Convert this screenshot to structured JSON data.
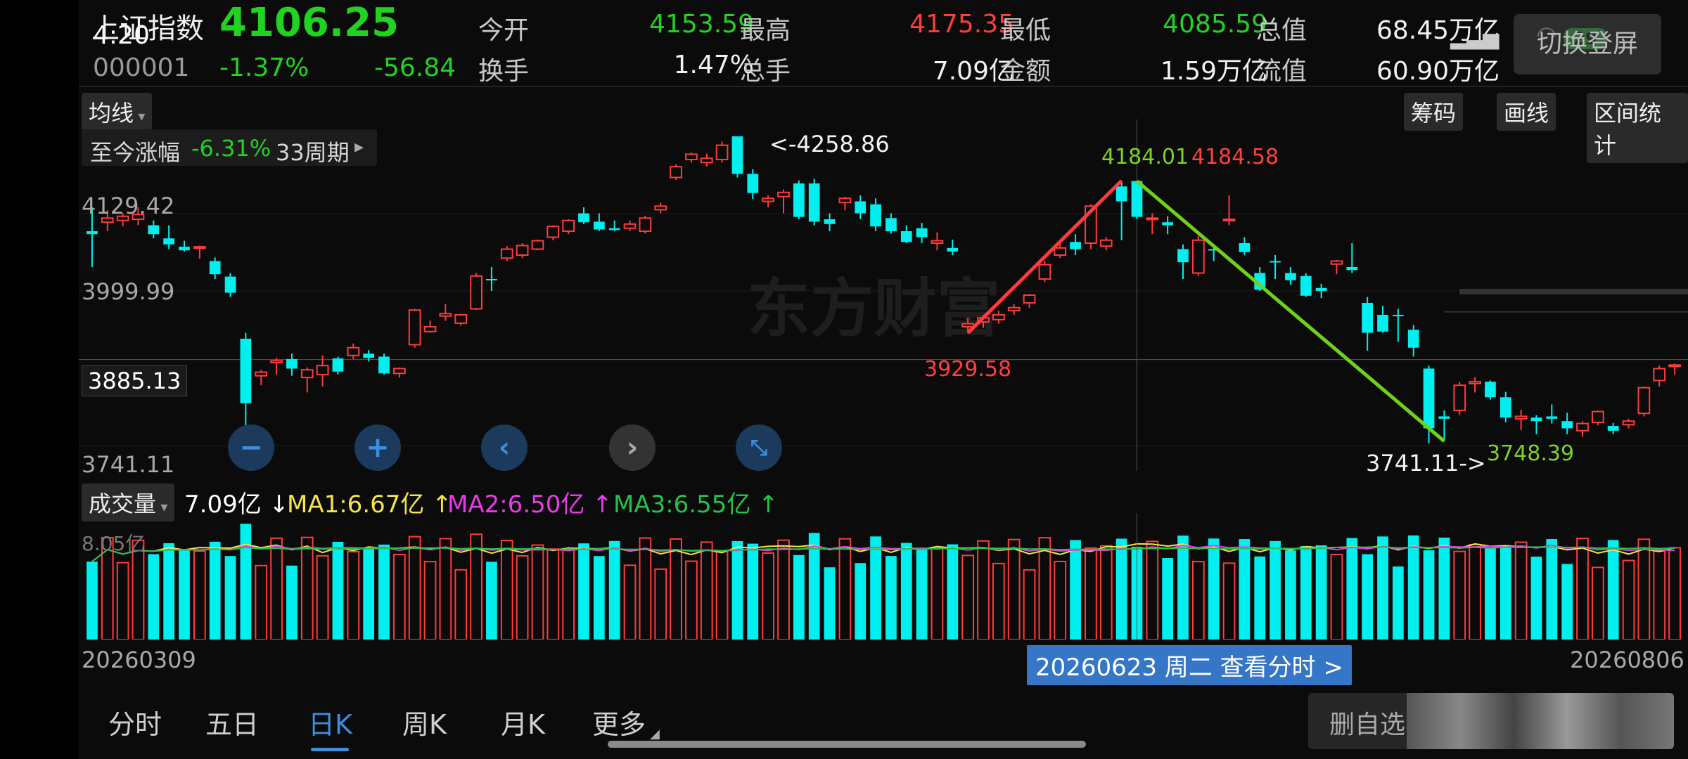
{
  "status": {
    "time": "4:20",
    "battery": "29"
  },
  "quote": {
    "name": "上证指数",
    "price": "4106.25",
    "code": "000001",
    "change_pct": "-1.37%",
    "change": "-56.84",
    "fields": [
      {
        "label": "今开",
        "value": "4153.59",
        "color": "dn"
      },
      {
        "label": "最高",
        "value": "4175.35",
        "color": "up"
      },
      {
        "label": "最低",
        "value": "4085.59",
        "color": "dn"
      },
      {
        "label": "总值",
        "value": "68.45万亿",
        "color": "wh"
      },
      {
        "label": "换手",
        "value": "1.47%",
        "color": "wh"
      },
      {
        "label": "总手",
        "value": "7.09亿",
        "color": "wh"
      },
      {
        "label": "金额",
        "value": "1.59万亿",
        "color": "wh"
      },
      {
        "label": "流值",
        "value": "60.90万亿",
        "color": "wh"
      }
    ],
    "action": "切换登屏"
  },
  "toolbar": {
    "ma_label": "均线",
    "tools": [
      "筹码",
      "画线",
      "区间统计"
    ]
  },
  "range": {
    "label": "至今涨幅",
    "pct": "-6.31%",
    "periods": "33周期"
  },
  "axis": {
    "y_labels": [
      "4129.42",
      "3999.99",
      "3885.13",
      "3741.11"
    ],
    "x_start": "20260309",
    "x_end": "20260806",
    "vol_max": "8.05亿"
  },
  "annotations": {
    "high_left": "<-4258.86",
    "green_top": "4184.01",
    "red_top": "4184.58",
    "red_low": "3929.58",
    "low_right": "3741.11->",
    "green_low": "3748.39"
  },
  "watermark": "东方财富",
  "volume": {
    "label": "成交量",
    "value": "7.09亿",
    "ma1": "MA1:6.67亿",
    "ma2": "MA2:6.50亿",
    "ma3": "MA3:6.55亿"
  },
  "crosshair": {
    "tip": "20260623 周二 查看分时 >"
  },
  "tabs": [
    "分时",
    "五日",
    "日K",
    "周K",
    "月K",
    "更多"
  ],
  "bottom": {
    "button": "删自选"
  },
  "chart_data": {
    "type": "candlestick",
    "title": "上证指数",
    "ylim": [
      3741.11,
      4258.86
    ],
    "ohlc": [
      [
        4100,
        4140,
        4040,
        4095
      ],
      [
        4115,
        4135,
        4100,
        4122
      ],
      [
        4118,
        4130,
        4108,
        4125
      ],
      [
        4120,
        4140,
        4110,
        4128
      ],
      [
        4110,
        4118,
        4088,
        4095
      ],
      [
        4088,
        4110,
        4070,
        4078
      ],
      [
        4074,
        4084,
        4066,
        4068
      ],
      [
        4072,
        4076,
        4054,
        4074
      ],
      [
        4050,
        4056,
        4020,
        4028
      ],
      [
        4024,
        4030,
        3990,
        3997
      ],
      [
        3920,
        3930,
        3770,
        3812
      ],
      [
        3858,
        3868,
        3842,
        3864
      ],
      [
        3880,
        3888,
        3860,
        3883
      ],
      [
        3886,
        3895,
        3858,
        3870
      ],
      [
        3855,
        3872,
        3830,
        3868
      ],
      [
        3860,
        3892,
        3840,
        3875
      ],
      [
        3887,
        3890,
        3860,
        3865
      ],
      [
        3892,
        3912,
        3886,
        3905
      ],
      [
        3895,
        3901,
        3882,
        3888
      ],
      [
        3890,
        3895,
        3860,
        3862
      ],
      [
        3862,
        3872,
        3855,
        3870
      ],
      [
        3910,
        3970,
        3905,
        3968
      ],
      [
        3932,
        3950,
        3930,
        3940
      ],
      [
        3958,
        3978,
        3950,
        3962
      ],
      [
        3946,
        3962,
        3942,
        3960
      ],
      [
        3970,
        4030,
        3968,
        4025
      ],
      [
        4020,
        4040,
        4000,
        4018
      ],
      [
        4055,
        4075,
        4050,
        4070
      ],
      [
        4060,
        4080,
        4055,
        4076
      ],
      [
        4070,
        4086,
        4068,
        4084
      ],
      [
        4090,
        4110,
        4085,
        4108
      ],
      [
        4100,
        4120,
        4095,
        4118
      ],
      [
        4130,
        4140,
        4112,
        4115
      ],
      [
        4116,
        4130,
        4100,
        4103
      ],
      [
        4105,
        4118,
        4100,
        4102
      ],
      [
        4105,
        4118,
        4100,
        4112
      ],
      [
        4100,
        4126,
        4096,
        4122
      ],
      [
        4136,
        4148,
        4130,
        4142
      ],
      [
        4190,
        4212,
        4186,
        4208
      ],
      [
        4220,
        4232,
        4215,
        4229
      ],
      [
        4215,
        4230,
        4208,
        4222
      ],
      [
        4220,
        4250,
        4215,
        4244
      ],
      [
        4258.86,
        4258.86,
        4190,
        4196
      ],
      [
        4196,
        4204,
        4154,
        4164
      ],
      [
        4150,
        4160,
        4140,
        4155
      ],
      [
        4158,
        4170,
        4130,
        4165
      ],
      [
        4180,
        4185,
        4120,
        4124
      ],
      [
        4180,
        4188,
        4110,
        4116
      ],
      [
        4120,
        4130,
        4100,
        4112
      ],
      [
        4148,
        4158,
        4135,
        4155
      ],
      [
        4150,
        4160,
        4120,
        4130
      ],
      [
        4145,
        4155,
        4100,
        4108
      ],
      [
        4122,
        4130,
        4096,
        4100
      ],
      [
        4100,
        4110,
        4080,
        4082
      ],
      [
        4105,
        4114,
        4080,
        4090
      ],
      [
        4080,
        4098,
        4068,
        4084
      ],
      [
        4072,
        4086,
        4060,
        4066
      ],
      [
        3940,
        3955,
        3930,
        3945
      ],
      [
        3948,
        3960,
        3938,
        3955
      ],
      [
        3952,
        3967,
        3945,
        3960
      ],
      [
        3967,
        3978,
        3960,
        3972
      ],
      [
        3980,
        3995,
        3972,
        3993
      ],
      [
        4020,
        4050,
        4015,
        4044
      ],
      [
        4060,
        4080,
        4055,
        4072
      ],
      [
        4082,
        4095,
        4060,
        4070
      ],
      [
        4080,
        4145,
        4070,
        4142
      ],
      [
        4075,
        4090,
        4068,
        4085
      ],
      [
        4175,
        4184.58,
        4085,
        4150
      ],
      [
        4184.01,
        4184.01,
        4120,
        4124
      ],
      [
        4120,
        4130,
        4095,
        4122
      ],
      [
        4115,
        4125,
        4095,
        4110
      ],
      [
        4070,
        4078,
        4020,
        4048
      ],
      [
        4030,
        4092,
        4025,
        4085
      ],
      [
        4070,
        4075,
        4050,
        4068
      ],
      [
        4120,
        4160,
        4110,
        4120
      ],
      [
        4080,
        4090,
        4060,
        4065
      ],
      [
        4030,
        4040,
        4000,
        4002
      ],
      [
        4050,
        4060,
        4020,
        4048
      ],
      [
        4030,
        4040,
        4010,
        4018
      ],
      [
        4025,
        4030,
        3990,
        3992
      ],
      [
        4005,
        4012,
        3988,
        4000
      ],
      [
        4045,
        4052,
        4028,
        4050
      ],
      [
        4040,
        4080,
        4030,
        4035
      ],
      [
        3980,
        3990,
        3900,
        3930
      ],
      [
        3960,
        3975,
        3930,
        3932
      ],
      [
        3960,
        3970,
        3915,
        3958
      ],
      [
        3935,
        3943,
        3890,
        3905
      ],
      [
        3870,
        3875,
        3745,
        3770
      ],
      [
        3790,
        3800,
        3748.39,
        3786
      ],
      [
        3800,
        3848,
        3792,
        3842
      ],
      [
        3845,
        3856,
        3830,
        3848
      ],
      [
        3848,
        3850,
        3818,
        3822
      ],
      [
        3822,
        3831,
        3780,
        3788
      ],
      [
        3786,
        3801,
        3767,
        3790
      ],
      [
        3788,
        3792,
        3760,
        3782
      ],
      [
        3790,
        3810,
        3778,
        3786
      ],
      [
        3782,
        3796,
        3760,
        3770
      ],
      [
        3766,
        3782,
        3756,
        3778
      ],
      [
        3780,
        3800,
        3775,
        3798
      ],
      [
        3774,
        3779,
        3760,
        3766
      ],
      [
        3776,
        3786,
        3770,
        3782
      ],
      [
        3795,
        3840,
        3790,
        3838
      ],
      [
        3850,
        3875,
        3840,
        3870
      ],
      [
        3876,
        3878,
        3860,
        3876
      ]
    ],
    "volume_label": "成交量",
    "volume_max": "8.05亿",
    "annotations": [
      "<-4258.86",
      "4184.01",
      "4184.58",
      "3929.58",
      "3741.11->",
      "3748.39"
    ]
  }
}
